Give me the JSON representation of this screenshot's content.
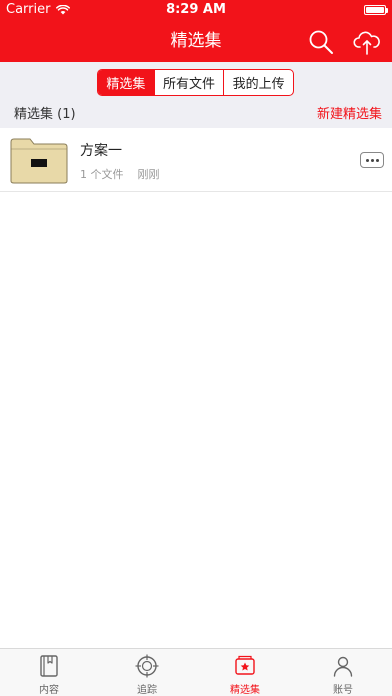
{
  "status_bar": {
    "carrier": "Carrier",
    "time": "8:29 AM"
  },
  "nav": {
    "title": "精选集"
  },
  "segments": [
    {
      "label": "精选集",
      "active": true
    },
    {
      "label": "所有文件",
      "active": false
    },
    {
      "label": "我的上传",
      "active": false
    }
  ],
  "section": {
    "title": "精选集 (1)",
    "action": "新建精选集"
  },
  "items": [
    {
      "title": "方案一",
      "file_count": "1 个文件",
      "time": "刚刚"
    }
  ],
  "tab_bar": {
    "tabs": [
      {
        "label": "内容",
        "icon": "book-icon",
        "active": false
      },
      {
        "label": "追踪",
        "icon": "target-icon",
        "active": false
      },
      {
        "label": "精选集",
        "icon": "collection-icon",
        "active": true
      },
      {
        "label": "账号",
        "icon": "user-icon",
        "active": false
      }
    ]
  },
  "colors": {
    "primary": "#f2131a",
    "folder": "#e8d9a8"
  }
}
